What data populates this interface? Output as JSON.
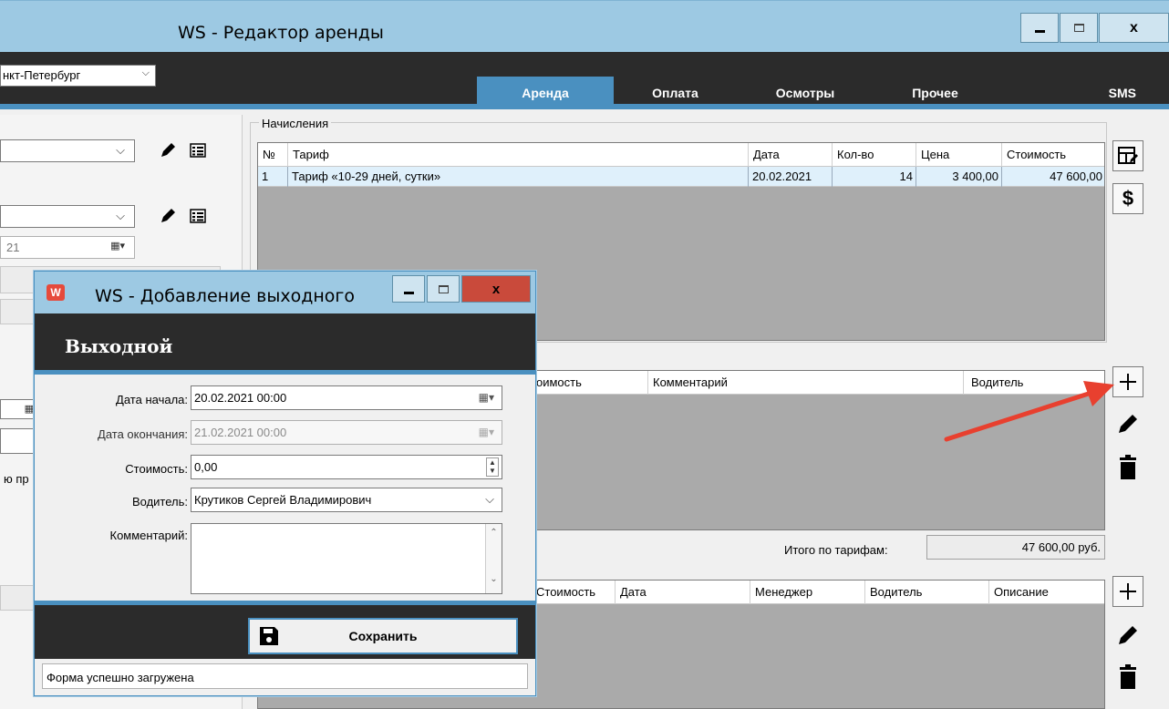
{
  "main_window": {
    "title": "WS - Редактор аренды",
    "city": "нкт-Петербург",
    "tabs": [
      "Аренда",
      "Оплата",
      "Осмотры",
      "Прочее",
      "SMS"
    ],
    "active_tab": "Аренда"
  },
  "left_panel": {
    "date_fragment": "21",
    "text_fragment": "ю пр"
  },
  "charges": {
    "legend": "Начисления",
    "columns": [
      "№",
      "Тариф",
      "Дата",
      "Кол-во",
      "Цена",
      "Стоимость"
    ],
    "rows": [
      {
        "num": "1",
        "tariff": "Тариф «10-29 дней, сутки»",
        "date": "20.02.2021",
        "qty": "14",
        "price": "3 400,00",
        "cost": "47 600,00"
      }
    ]
  },
  "days_off_grid": {
    "columns": [
      "оимость",
      "Комментарий",
      "Водитель"
    ]
  },
  "totals": {
    "label": "Итого по тарифам:",
    "value": "47 600,00 руб."
  },
  "extra_grid": {
    "columns": [
      "Стоимость",
      "Дата",
      "Менеджер",
      "Водитель",
      "Описание"
    ]
  },
  "dialog": {
    "title": "WS - Добавление выходного",
    "app_icon": "W",
    "heading": "Выходной",
    "fields": {
      "start_label": "Дата начала:",
      "start_value": "20.02.2021 00:00",
      "end_label": "Дата окончания:",
      "end_value": "21.02.2021 00:00",
      "cost_label": "Стоимость:",
      "cost_value": "0,00",
      "driver_label": "Водитель:",
      "driver_value": "Крутиков Сергей Владимирович",
      "comment_label": "Комментарий:"
    },
    "save_label": "Сохранить",
    "status": "Форма успешно загружена"
  },
  "colors": {
    "titlebar": "#9dc9e3",
    "dark_header": "#2b2b2b",
    "accent": "#4a90c0",
    "grid_bg": "#aaaaaa",
    "arrow": "#e8402f"
  }
}
